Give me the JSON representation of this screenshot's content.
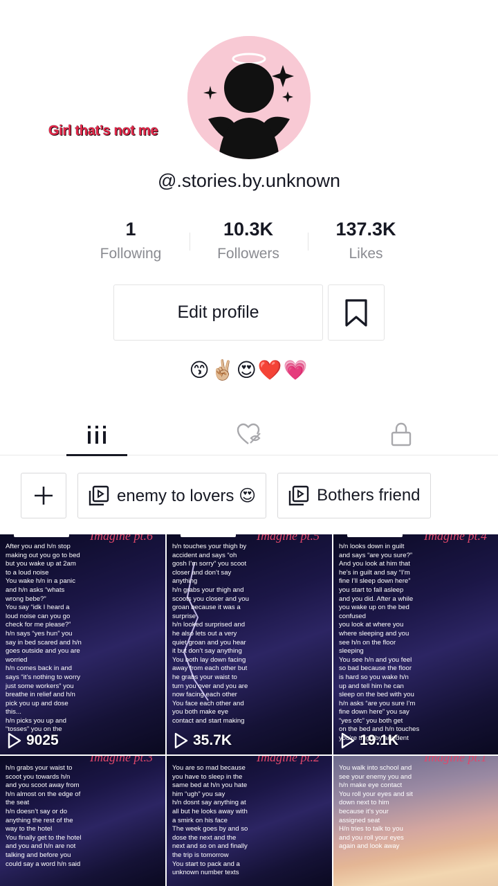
{
  "profile": {
    "caption_overlay": "Girl that’s not me",
    "username": "@.stories.by.unknown",
    "emojis": "😙✌🏼😍❤️💗"
  },
  "stats": [
    {
      "value": "1",
      "label": "Following"
    },
    {
      "value": "10.3K",
      "label": "Followers"
    },
    {
      "value": "137.3K",
      "label": "Likes"
    }
  ],
  "actions": {
    "edit_profile": "Edit profile",
    "bookmark_icon": "bookmark-icon"
  },
  "tabs": [
    {
      "icon": "grid-icon",
      "active": true
    },
    {
      "icon": "liked-hidden-icon",
      "active": false
    },
    {
      "icon": "lock-icon",
      "active": false
    }
  ],
  "playlists": [
    {
      "label": "enemy to lovers 😍"
    },
    {
      "label": "Bothers friend"
    }
  ],
  "videos": [
    {
      "title": "Imagine pt.6",
      "views": "9025",
      "text": "After you and h/n stop\nmaking out you go to bed\nbut you wake up at 2am\nto a loud noise\n      You wake h/n in a panic\n      and h/n asks “whats\n      wrong bebe?”\nYou say “idk I heard a\nloud noise can you go\ncheck for me please?”\n      h/n says “yes hun” you\n      say in bed scared and h/n\n      goes outside and you are\n      worried\nh/n comes back in and\nsays “it’s nothing to worry\njust some workers” you\nbreathe in relief and h/n\npick you up and dose\nthis...\n      h/n picks you up and\n      “tosses” you on the"
    },
    {
      "title": "Imagine pt.5",
      "views": "35.7K",
      "text": "h/n touches your thigh by\naccident and says “oh\ngosh I’m sorry” you scoot\ncloser and don’t say\nanything\n      h/n grabs your thigh and\n      scoots you closer and you\n      groan because it was a\n      surprise\nh/n looked surprised and\nhe also lets out a very\nquiet groan and you hear\nit but don’t say anything\n      You both lay down facing\n      away from each other but\n      he grabs your waist to\n      turn you over and you are\n      now facing each other\nYou face each other and\nyou both make eye\ncontact and start making"
    },
    {
      "title": "Imagine pt.4",
      "views": "19.1K",
      "text": "h/n looks down in guilt\nand says “are you sure?”\nAnd you look at him that\nhe’s in guilt and say “I’m\nfine I’ll sleep down here”\n      you start to fall asleep\n      and you did. After a while\n      you wake up on the bed\n      confused\nyou look at where you\nwhere sleeping and you\nsee h/n on the floor\nsleeping\n      You see h/n and you feel\n      so bad because the floor\n      is hard so you wake h/n\n      up and tell him he can\n      sleep on the bed with you\nh/n asks “are you sure I’m\nfine down here” you say\n“yes ofc” you both get\non the bed and h/n touches\nyou’re thigh by accident"
    },
    {
      "title": "Imagine pt.3",
      "views": "",
      "text": "h/n grabs your waist to\nscoot you towards h/n\nand you scoot away from\nh/n almost on the edge of\nthe seat\n      h/n doesn’t say or do\n      anything the rest of the\n      way to the hotel\nYou finally get to the hotel\nand you and h/n are not\ntalking and before you\ncould say a word h/n said"
    },
    {
      "title": "Imagine pt.2",
      "views": "",
      "text": "You are so mad because\nyou have to sleep in the\nsame bed at h/n you hate\nhim “ugh” you say\n      h/n dosnt say anything at\n      all but he looks away with\n      a smirk on his face\nThe week goes by and so\ndose the next and the\nnext and so on and finally\nthe trip is tomorrow\n      You start to pack and a\n      unknown number texts"
    },
    {
      "title": "Imagine pt.1",
      "views": "",
      "text": "You walk into school and\nsee your enemy you and\nh/n make eye contact\n      You roll your eyes and sit\n      down next to him\n      because it’s your\n      assigned seat\nH/n tries to talk to you\nand you roll your eyes\nagain and look away"
    }
  ],
  "colors": {
    "text_primary": "#161823",
    "text_secondary": "#8a8b91",
    "border": "#e3e3e4",
    "avatar_bg": "#f8c9d4",
    "caption_red": "#e6274a"
  }
}
